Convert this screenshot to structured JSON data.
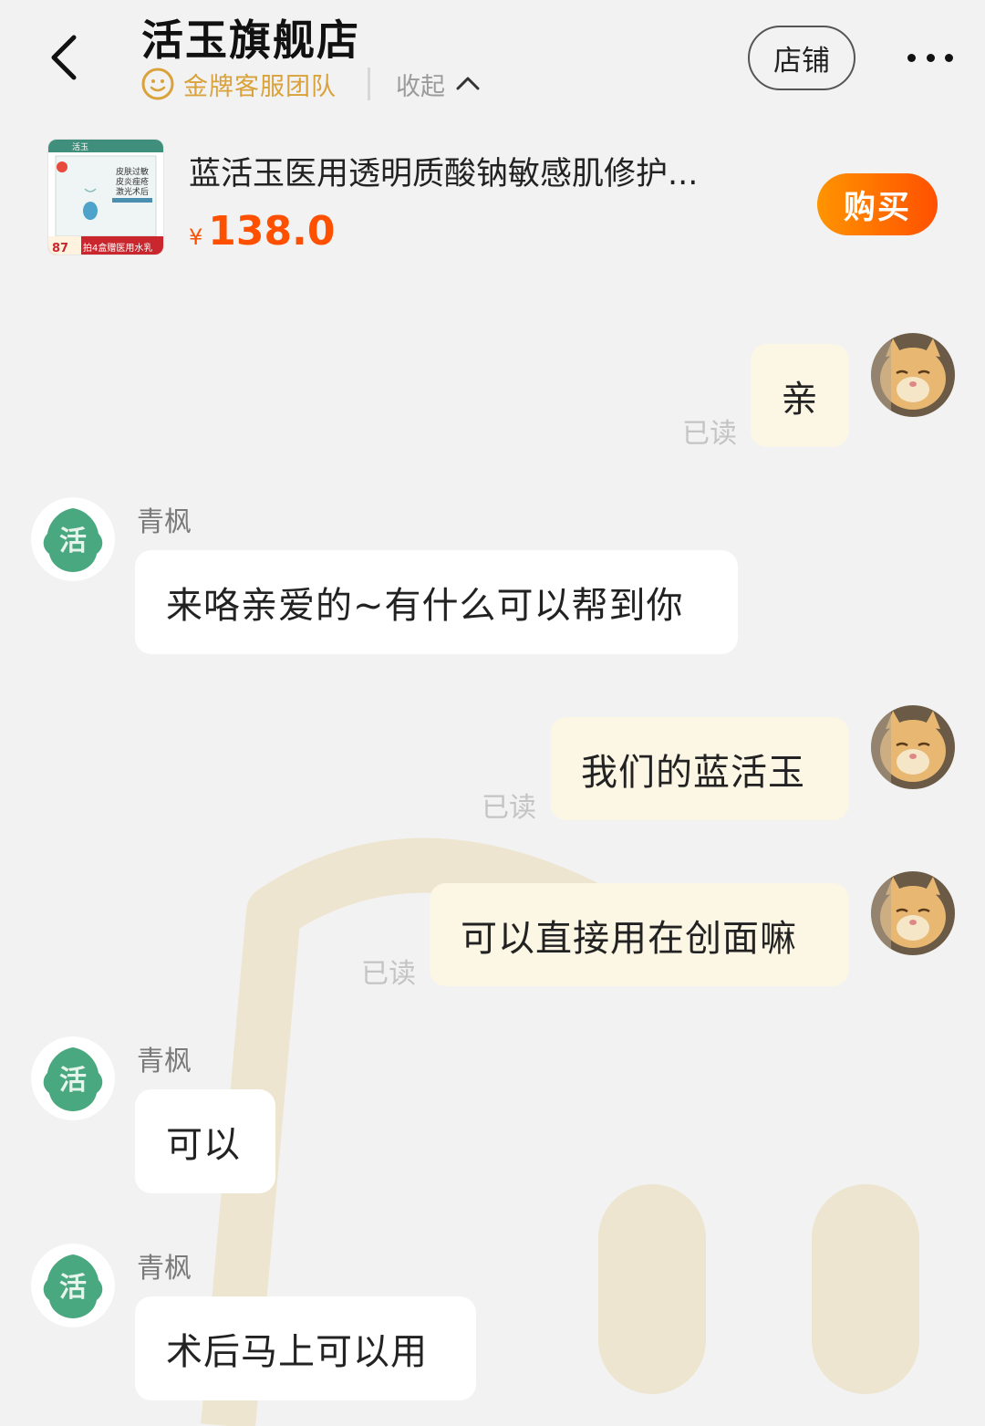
{
  "header": {
    "title": "活玉旗舰店",
    "team_label": "金牌客服团队",
    "collapse_label": "收起",
    "store_button": "店铺"
  },
  "product": {
    "name": "蓝活玉医用透明质酸钠敏感肌修护...",
    "currency": "¥",
    "price": "138.0",
    "buy_button": "购买",
    "thumb": {
      "brand": "活玉",
      "tags": [
        "皮肤过敏",
        "皮炎痤疮",
        "激光术后"
      ],
      "promo_price": "87",
      "promo_text": "拍4盒赠医用水乳"
    }
  },
  "messages": [
    {
      "side": "out",
      "text": "亲",
      "status": "已读"
    },
    {
      "side": "in",
      "sender": "青枫",
      "text": "来咯亲爱的~有什么可以帮到你"
    },
    {
      "side": "out",
      "text": "我们的蓝活玉",
      "status": "已读"
    },
    {
      "side": "out",
      "text": "可以直接用在创面嘛",
      "status": "已读"
    },
    {
      "side": "in",
      "sender": "青枫",
      "text": "可以"
    },
    {
      "side": "in",
      "sender": "青枫",
      "text": "术后马上可以用"
    }
  ],
  "colors": {
    "accent": "#ff5000",
    "gold": "#d9a23a",
    "outgoing_bubble": "#fcf6e4",
    "incoming_bubble": "#ffffff",
    "background": "#f2f2f2"
  }
}
